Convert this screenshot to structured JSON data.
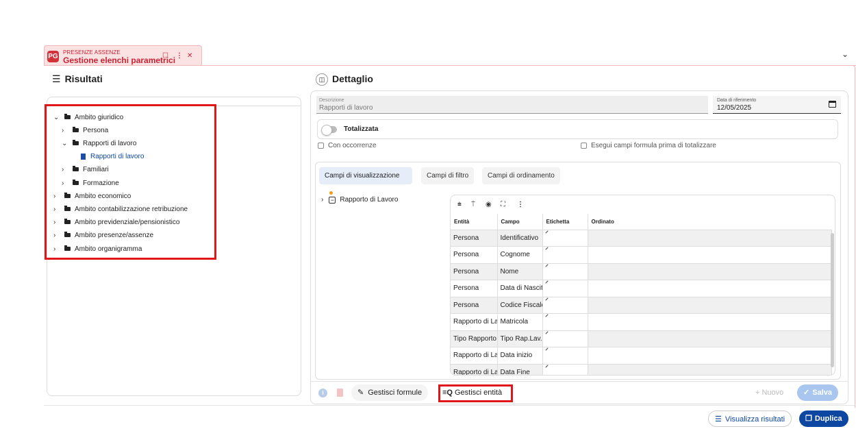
{
  "tab": {
    "module": "PRESENZE ASSENZE",
    "title": "Gestione elenchi parametrici",
    "logo": "PG"
  },
  "left": {
    "title": "Risultati"
  },
  "tree": [
    {
      "label": "Ambito giuridico",
      "arrow": "⌄"
    },
    {
      "label": "Persona",
      "arrow": "›"
    },
    {
      "label": "Rapporti di lavoro",
      "arrow": "⌄"
    },
    {
      "label": "Rapporti di lavoro",
      "arrow": ""
    },
    {
      "label": "Familiari",
      "arrow": "›"
    },
    {
      "label": "Formazione",
      "arrow": "›"
    },
    {
      "label": "Ambito economico",
      "arrow": "›"
    },
    {
      "label": "Ambito contabilizzazione retribuzione",
      "arrow": "›"
    },
    {
      "label": "Ambito previdenziale/pensionistico",
      "arrow": "›"
    },
    {
      "label": "Ambito presenze/assenze",
      "arrow": "›"
    },
    {
      "label": "Ambito organigramma",
      "arrow": "›"
    }
  ],
  "detail": {
    "title": "Dettaglio",
    "descrizione_label": "Descrizione",
    "descrizione_value": "Rapporti di lavoro",
    "data_label": "Data di riferimento",
    "data_value": "12/05/2025",
    "totalizzata": "Totalizzata",
    "con_occorrenze": "Con occorrenze",
    "esegui": "Esegui campi formula prima di totalizzare"
  },
  "subtabs": [
    "Campi di visualizzazione",
    "Campi di filtro",
    "Campi di ordinamento"
  ],
  "entity_tree": {
    "label": "Rapporto di Lavoro"
  },
  "grid": {
    "headers": [
      "Entità",
      "Campo",
      "Etichetta",
      "Ordinato"
    ],
    "rows": [
      [
        "Persona",
        "Identificativo"
      ],
      [
        "Persona",
        "Cognome"
      ],
      [
        "Persona",
        "Nome"
      ],
      [
        "Persona",
        "Data di Nascita"
      ],
      [
        "Persona",
        "Codice Fiscale"
      ],
      [
        "Rapporto di Lavoro",
        "Matricola"
      ],
      [
        "Tipo Rapporto",
        "Tipo Rap.Lav."
      ],
      [
        "Rapporto di Lavoro",
        "Data inizio"
      ],
      [
        "Rapporto di Lavoro",
        "Data Fine"
      ]
    ]
  },
  "actions": {
    "gestisci_formule": "Gestisci formule",
    "gestisci_entita": "Gestisci entità",
    "nuovo": "+ Nuovo",
    "salva": "Salva",
    "visualizza": "Visualizza risultati",
    "duplica": "Duplica"
  },
  "colors": {
    "accent": "#0d47a1",
    "tab": "#fbe3e4",
    "highlight": "#e0161b",
    "dot": "#f39c12"
  }
}
